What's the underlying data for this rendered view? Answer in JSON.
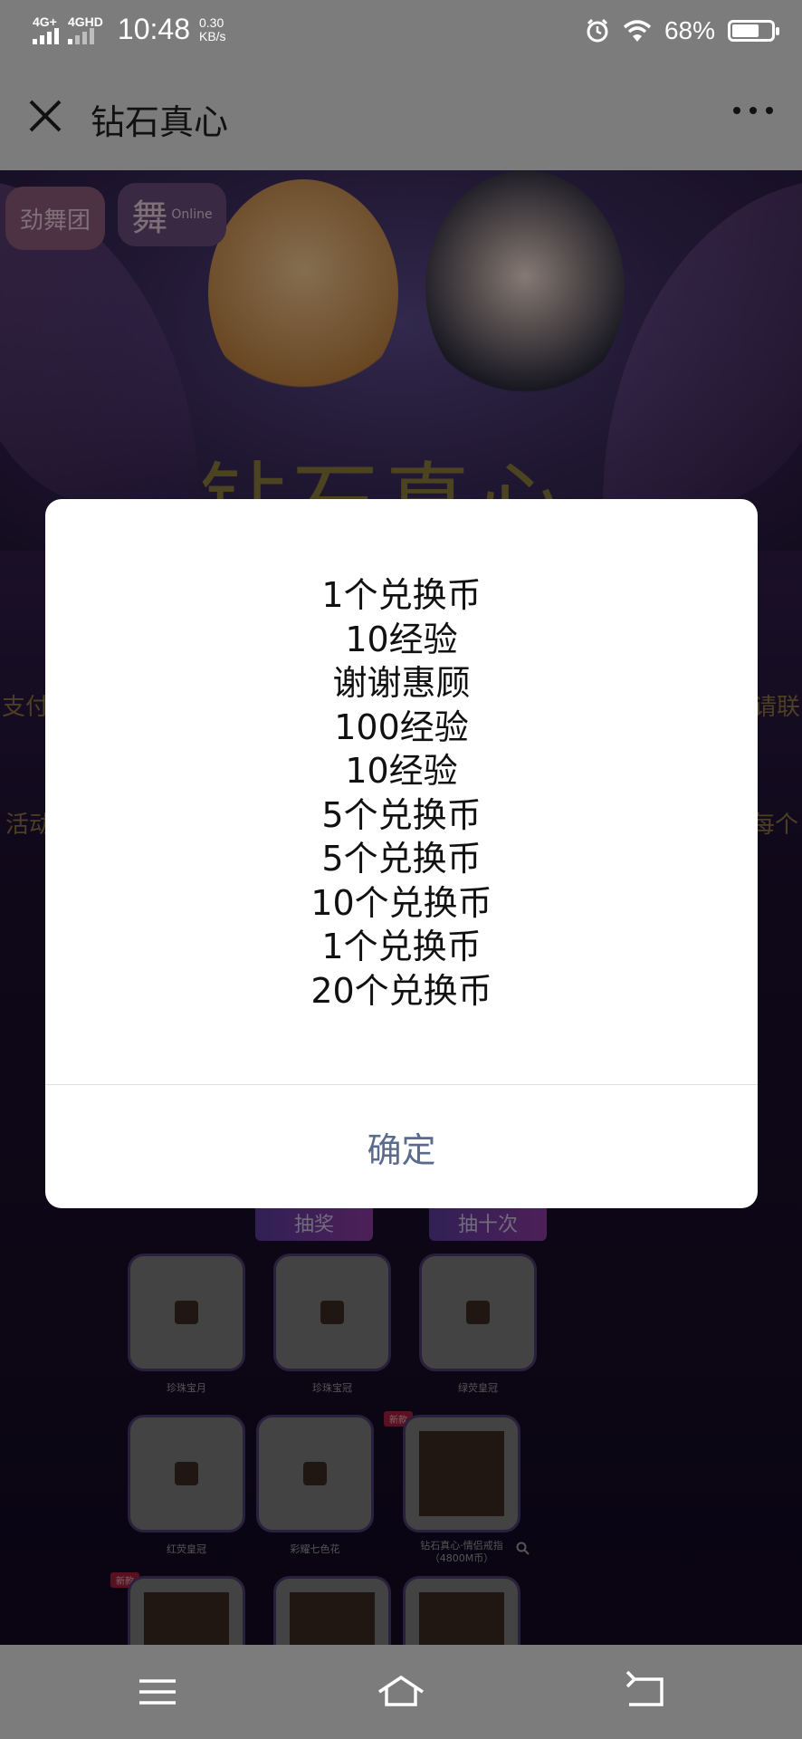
{
  "status_bar": {
    "network_1": "4G+",
    "network_2": "4GHD",
    "time": "10:48",
    "speed_value": "0.30",
    "speed_unit": "KB/s",
    "battery_pct": "68%",
    "battery_level": 0.68
  },
  "titlebar": {
    "title": "钻石真心",
    "close_icon": "close-icon",
    "more_icon": "more-icon"
  },
  "content": {
    "banner_title": "钻石真心",
    "logo_left": "劲舞团",
    "logo_right": "舞",
    "logo_right_sub": "Online",
    "side_left_1": "支付",
    "side_right_1": "请联",
    "side_left_2": "活动",
    "side_right_2": "每个",
    "draw_button": "抽奖",
    "draw_ten_button": "抽十次",
    "new_tag": "新款",
    "prizes": [
      {
        "label": "珍珠宝月"
      },
      {
        "label": "珍珠宝冠"
      },
      {
        "label": "绿荧皇冠"
      },
      {
        "label": "红荧皇冠"
      },
      {
        "label": "彩耀七色花"
      },
      {
        "label": "钻石真心·情侣戒指",
        "sub": "（4800M币）"
      }
    ]
  },
  "dialog": {
    "results": [
      "1个兑换币",
      "10经验",
      "谢谢惠顾",
      "100经验",
      "10经验",
      "5个兑换币",
      "5个兑换币",
      "10个兑换币",
      "1个兑换币",
      "20个兑换币"
    ],
    "confirm_label": "确定"
  },
  "navbar": {
    "menu_icon": "menu-icon",
    "home_icon": "home-icon",
    "back_icon": "back-icon"
  },
  "colors": {
    "overlay_gray": "#7c7c7c",
    "dialog_bg": "#ffffff",
    "confirm_text": "#5b6b8c"
  }
}
